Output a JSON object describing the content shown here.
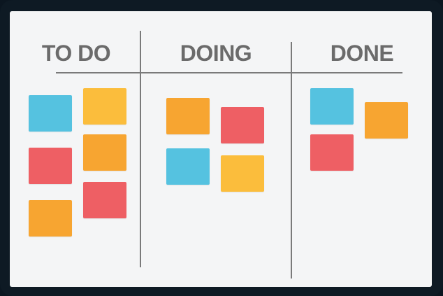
{
  "colors": {
    "frame": "#0e1a24",
    "board": "#f4f5f6",
    "line": "#7a7a7a",
    "heading": "#6b6b6b",
    "blue": "#55c2e0",
    "orange": "#f7a531",
    "yellow": "#fbbd3c",
    "red": "#ee5f64"
  },
  "columns": [
    {
      "title": "TO DO",
      "cards": [
        {
          "color": "blue"
        },
        {
          "color": "yellow"
        },
        {
          "color": "orange"
        },
        {
          "color": "red"
        },
        {
          "color": "red"
        },
        {
          "color": "orange"
        }
      ]
    },
    {
      "title": "DOING",
      "cards": [
        {
          "color": "orange"
        },
        {
          "color": "red"
        },
        {
          "color": "blue"
        },
        {
          "color": "yellow"
        }
      ]
    },
    {
      "title": "DONE",
      "cards": [
        {
          "color": "blue"
        },
        {
          "color": "orange"
        },
        {
          "color": "red"
        }
      ]
    }
  ]
}
